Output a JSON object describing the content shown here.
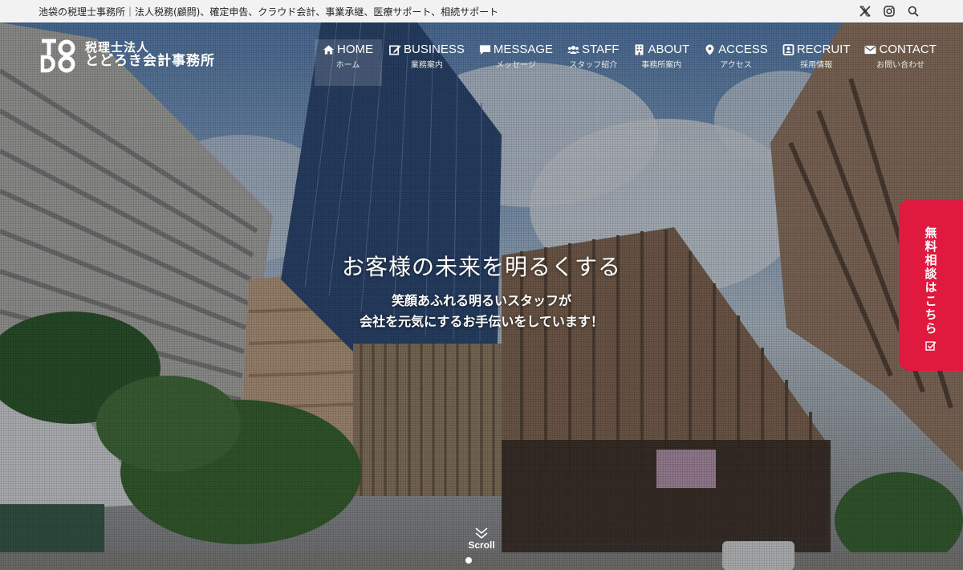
{
  "topbar": {
    "text": "池袋の税理士事務所｜法人税務(顧問)、確定申告、クラウド会計、事業承継、医療サポート、相続サポート",
    "icons": [
      "x-icon",
      "instagram-icon",
      "search-icon"
    ]
  },
  "logo": {
    "mark": "TODO",
    "line1": "税理士法人",
    "line2": "とどろき会計事務所"
  },
  "nav": {
    "items": [
      {
        "en": "HOME",
        "ja": "ホーム",
        "icon": "home-icon",
        "active": true
      },
      {
        "en": "BUSINESS",
        "ja": "業務案内",
        "icon": "edit-icon"
      },
      {
        "en": "MESSAGE",
        "ja": "メッセージ",
        "icon": "speech-bubble-icon"
      },
      {
        "en": "STAFF",
        "ja": "スタッフ紹介",
        "icon": "users-icon"
      },
      {
        "en": "ABOUT",
        "ja": "事務所案内",
        "icon": "building-icon"
      },
      {
        "en": "ACCESS",
        "ja": "アクセス",
        "icon": "map-pin-icon"
      },
      {
        "en": "RECRUIT",
        "ja": "採用情報",
        "icon": "id-card-icon"
      },
      {
        "en": "CONTACT",
        "ja": "お問い合わせ",
        "icon": "envelope-icon"
      }
    ]
  },
  "hero": {
    "title": "お客様の未来を明るくする",
    "sub1": "笑顔あふれる明るいスタッフが",
    "sub2": "会社を元気にするお手伝いをしています！"
  },
  "consult": {
    "label": "無料相談はこちら",
    "icon": "check-square-icon"
  },
  "scroll": {
    "label": "Scroll",
    "icon": "chevron-down-icon"
  },
  "colors": {
    "accent": "#e0193f",
    "topbar_bg": "#f2f2f2"
  }
}
